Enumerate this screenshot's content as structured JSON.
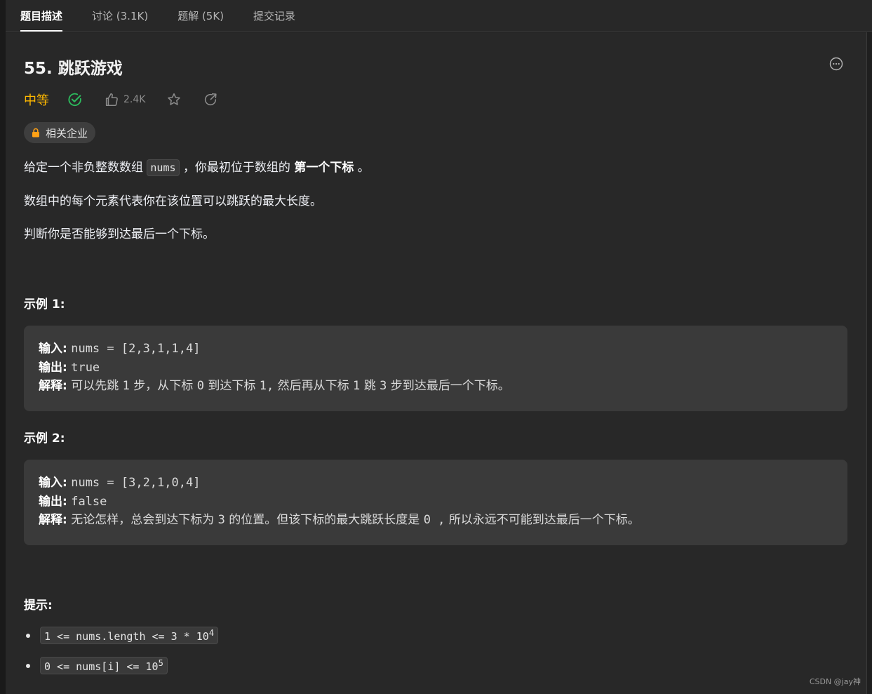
{
  "tabs": [
    {
      "label": "题目描述",
      "active": true
    },
    {
      "label": "讨论 (3.1K)",
      "active": false
    },
    {
      "label": "题解 (5K)",
      "active": false
    },
    {
      "label": "提交记录",
      "active": false
    }
  ],
  "problem": {
    "title": "55. 跳跃游戏",
    "difficulty": "中等",
    "likes": "2.4K",
    "company_tag": "相关企业",
    "icons": {
      "more": "more-horizontal-icon",
      "solved": "check-circle-icon",
      "like": "thumbs-up-icon",
      "favorite": "star-icon",
      "share": "share-icon",
      "lock": "lock-icon"
    }
  },
  "description": {
    "p1_prefix": "给定一个非负整数数组",
    "p1_code": "nums",
    "p1_middle": "，你最初位于数组的",
    "p1_bold": "第一个下标",
    "p1_suffix": "。",
    "p2": "数组中的每个元素代表你在该位置可以跳跃的最大长度。",
    "p3": "判断你是否能够到达最后一个下标。"
  },
  "examples": [
    {
      "title": "示例 1:",
      "input_label": "输入:",
      "input": "nums = [2,3,1,1,4]",
      "output_label": "输出:",
      "output": "true",
      "explain_label": "解释:",
      "explain_1": "可以先跳",
      "explain_2": "1",
      "explain_3": "步，从下标",
      "explain_4": "0",
      "explain_5": "到达下标",
      "explain_6": "1,",
      "explain_7": "然后再从下标",
      "explain_8": "1",
      "explain_9": "跳",
      "explain_10": "3",
      "explain_11": "步到达最后一个下标。"
    },
    {
      "title": "示例 2:",
      "input_label": "输入:",
      "input": "nums = [3,2,1,0,4]",
      "output_label": "输出:",
      "output": "false",
      "explain_label": "解释:",
      "explain_1": "无论怎样，总会到达下标为",
      "explain_2": "3",
      "explain_3": "的位置。但该下标的最大跳跃长度是",
      "explain_4": "0 ,",
      "explain_5": "所以永远不可能到达最后一个下标。"
    }
  ],
  "constraints": {
    "title": "提示:",
    "items": [
      {
        "text": "1 <= nums.length <= 3 * 10",
        "sup": "4"
      },
      {
        "text": "0 <= nums[i] <= 10",
        "sup": "5"
      }
    ]
  },
  "watermark": "CSDN @jay神",
  "colors": {
    "background": "#282828",
    "difficulty_medium": "#ffb800",
    "solved": "#2cbb5d"
  }
}
